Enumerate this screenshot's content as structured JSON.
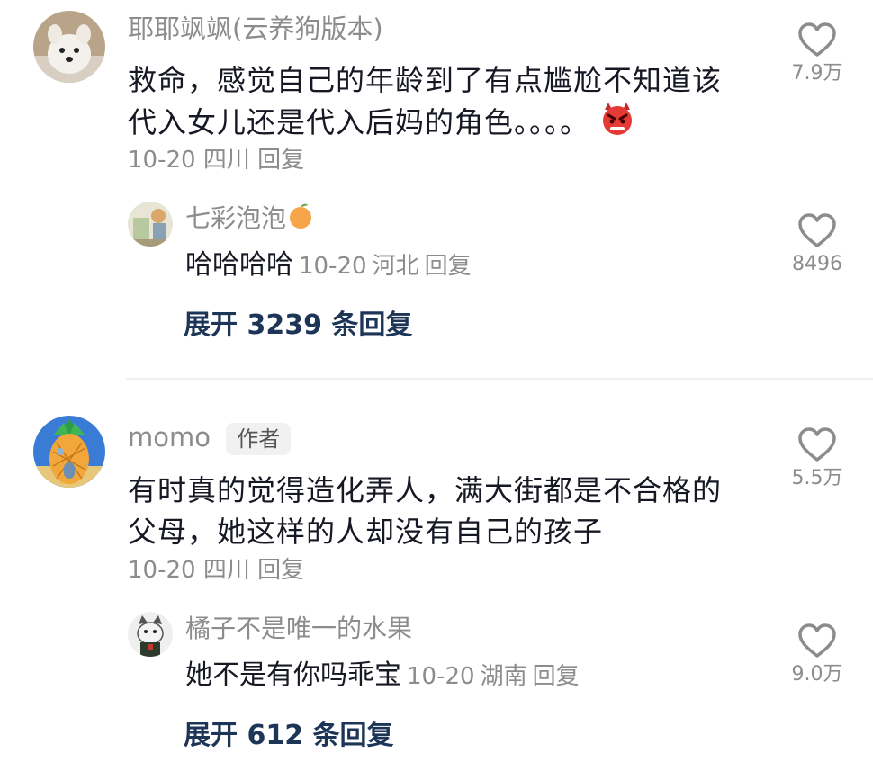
{
  "comments": [
    {
      "username": "耶耶飒飒(云养狗版本)",
      "text": "救命，感觉自己的年龄到了有点尴尬不知道该代入女儿还是代入后妈的角色。。。。",
      "date": "10-20",
      "location": "四川",
      "reply_label": "回复",
      "likes": "7.9万",
      "avatar_icon": "samoyed-dog-avatar",
      "emoji_icon": "angry-devil-emoji",
      "sub_reply": {
        "username": "七彩泡泡",
        "name_emoji_icon": "orange-fruit-emoji",
        "text": "哈哈哈哈",
        "date": "10-20",
        "location": "河北",
        "reply_label": "回复",
        "likes": "8496",
        "avatar_icon": "cartoon-illustration-avatar"
      },
      "expand_label": "展开 3239 条回复"
    },
    {
      "username": "momo",
      "badge": "作者",
      "text": "有时真的觉得造化弄人，满大街都是不合格的父母，她这样的人却没有自己的孩子",
      "date": "10-20",
      "location": "四川",
      "reply_label": "回复",
      "likes": "5.5万",
      "avatar_icon": "pineapple-house-avatar",
      "sub_reply": {
        "username": "橘子不是唯一的水果",
        "text": "她不是有你吗乖宝",
        "date": "10-20",
        "location": "湖南",
        "reply_label": "回复",
        "likes": "9.0万",
        "avatar_icon": "cat-avatar"
      },
      "expand_label": "展开 612 条回复"
    }
  ],
  "colors": {
    "text_primary": "#161823",
    "text_secondary": "#8c8c8c",
    "expand_link": "#1d3557",
    "badge_bg": "#f1f1f2"
  }
}
